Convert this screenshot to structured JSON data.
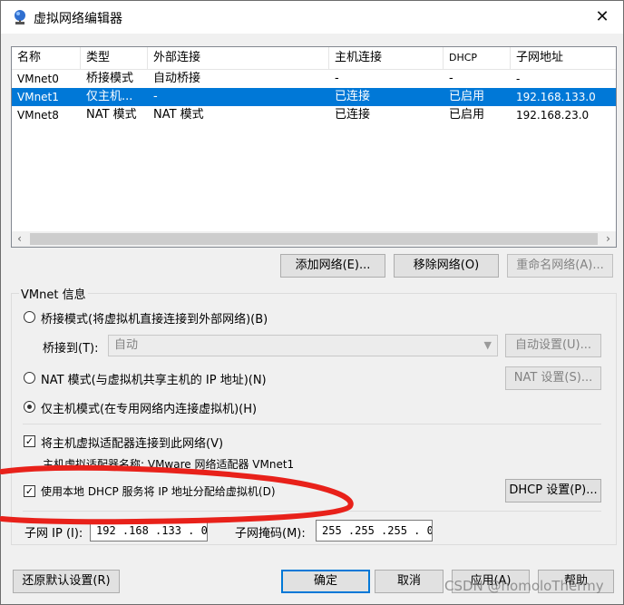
{
  "window": {
    "title": "虚拟网络编辑器",
    "close_glyph": "✕"
  },
  "table": {
    "columns": [
      "名称",
      "类型",
      "外部连接",
      "主机连接",
      "DHCP",
      "子网地址"
    ],
    "rows": [
      {
        "name": "VMnet0",
        "type": "桥接模式",
        "external": "自动桥接",
        "host": "-",
        "dhcp": "-",
        "subnet": "-"
      },
      {
        "name": "VMnet1",
        "type": "仅主机...",
        "external": "-",
        "host": "已连接",
        "dhcp": "已启用",
        "subnet": "192.168.133.0"
      },
      {
        "name": "VMnet8",
        "type": "NAT 模式",
        "external": "NAT 模式",
        "host": "已连接",
        "dhcp": "已启用",
        "subnet": "192.168.23.0"
      }
    ],
    "selected_row": "VMnet1",
    "scroll_left": "‹",
    "scroll_right": "›"
  },
  "buttons": {
    "add_network": "添加网络(E)...",
    "remove_network": "移除网络(O)",
    "rename_network": "重命名网络(A)...",
    "auto_settings": "自动设置(U)...",
    "nat_settings": "NAT 设置(S)...",
    "dhcp_settings": "DHCP 设置(P)...",
    "restore_defaults": "还原默认设置(R)",
    "ok": "确定",
    "cancel": "取消",
    "apply": "应用(A)",
    "help": "帮助"
  },
  "vmnet_info": {
    "group_title": "VMnet 信息",
    "bridged_label": "桥接模式(将虚拟机直接连接到外部网络)(B)",
    "bridge_to_label": "桥接到(T):",
    "bridge_to_value": "自动",
    "nat_label": "NAT 模式(与虚拟机共享主机的 IP 地址)(N)",
    "host_only_label": "仅主机模式(在专用网络内连接虚拟机)(H)",
    "selected_mode": "host_only",
    "connect_adapter_label": "将主机虚拟适配器连接到此网络(V)",
    "connect_adapter_checked": true,
    "adapter_name_label": "主机虚拟适配器名称: VMware 网络适配器 VMnet1",
    "use_dhcp_label": "使用本地 DHCP 服务将 IP 地址分配给虚拟机(D)",
    "use_dhcp_checked": true,
    "subnet_ip_label": "子网 IP (I):",
    "subnet_ip_value": "192 .168 .133 . 0",
    "subnet_mask_label": "子网掩码(M):",
    "subnet_mask_value": "255 .255 .255 . 0"
  },
  "watermark": "CSDN @homoloThermy",
  "colors": {
    "selection": "#0078d7",
    "annotation_red": "#e8211a"
  }
}
